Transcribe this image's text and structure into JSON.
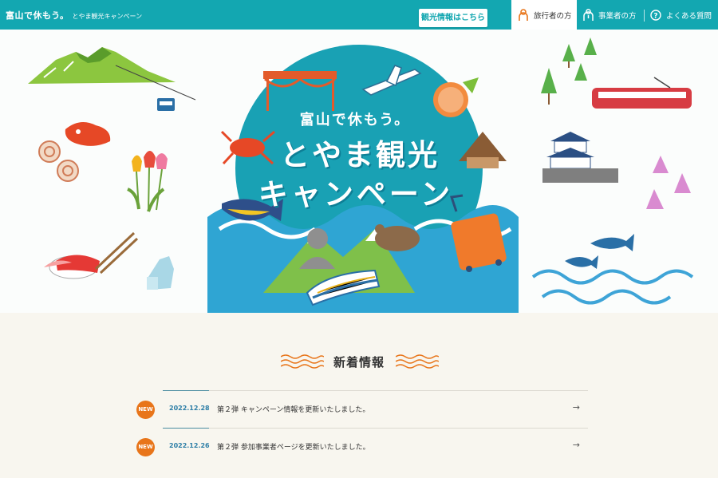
{
  "header": {
    "logo_main": "富山で休もう。",
    "logo_sub": "とやま観光キャンペーン",
    "info_button": "観光情報はこちら",
    "nav": [
      {
        "label": "旅行者の方",
        "icon": "traveler-icon",
        "active": true
      },
      {
        "label": "事業者の方",
        "icon": "business-icon",
        "active": false
      },
      {
        "label": "よくある質問",
        "icon": "question-icon",
        "active": false
      }
    ]
  },
  "hero": {
    "tagline": "富山で休もう。",
    "title_line1": "とやま観光",
    "title_line2": "キャンペーン"
  },
  "news": {
    "heading": "新着情報",
    "items": [
      {
        "badge": "NEW",
        "date": "2022.12.28",
        "text": "第２弾 キャンペーン情報を更新いたしました。",
        "arrow": "→"
      },
      {
        "badge": "NEW",
        "date": "2022.12.26",
        "text": "第２弾 参加事業者ページを更新いたしました。",
        "arrow": "→"
      }
    ]
  },
  "colors": {
    "header_bg": "#13a7b1",
    "badge": "#e8751a",
    "date": "#2d7ea6",
    "page_bg": "#f8f6ef"
  }
}
